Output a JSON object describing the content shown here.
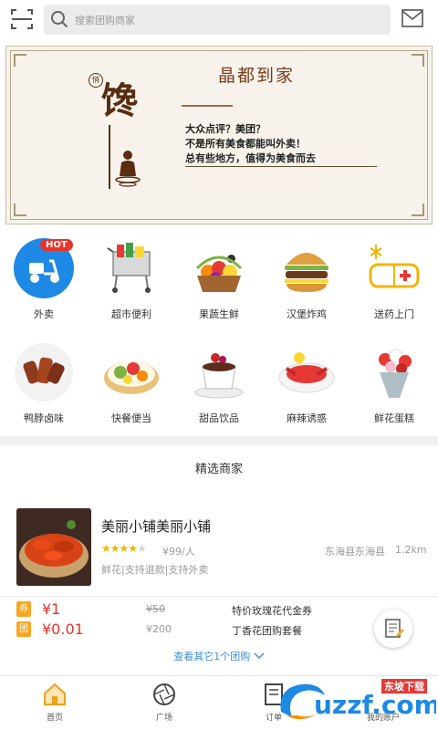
{
  "header": {
    "search_placeholder": "搜索团购商家"
  },
  "banner": {
    "brand": "晶都到家",
    "big_char": "馋",
    "seal_char": "悄",
    "taglines": [
      "大众点评？美团？",
      "不是所有美食都能叫外卖！",
      "总有些地方，值得为美食而去"
    ]
  },
  "categories": [
    {
      "label": "外卖",
      "icon": "scooter-icon",
      "hot": "HOT"
    },
    {
      "label": "超市便利",
      "icon": "shopping-cart-icon"
    },
    {
      "label": "果蔬生鲜",
      "icon": "fruit-basket-icon"
    },
    {
      "label": "汉堡炸鸡",
      "icon": "burger-icon"
    },
    {
      "label": "送药上门",
      "icon": "medicine-icon"
    },
    {
      "label": "鸭脖卤味",
      "icon": "braised-duck-icon"
    },
    {
      "label": "快餐便当",
      "icon": "bento-icon"
    },
    {
      "label": "甜品饮品",
      "icon": "dessert-cup-icon"
    },
    {
      "label": "麻辣诱惑",
      "icon": "crayfish-icon"
    },
    {
      "label": "鲜花蛋糕",
      "icon": "flower-bouquet-icon"
    }
  ],
  "section_title": "精选商家",
  "merchant": {
    "name": "美丽小铺美丽小铺",
    "rating": 4,
    "rating_max": 5,
    "price": "¥99/人",
    "location": "东海县东海县",
    "distance": "1.2km",
    "tags": "鲜花|支持退款|支持外卖"
  },
  "deals": [
    {
      "badge": "券",
      "badge_color": "#f7a623",
      "price": "¥1",
      "original": "¥50",
      "strike": true,
      "name": "特价玫瑰花代金券"
    },
    {
      "badge": "团",
      "badge_color": "#f7a623",
      "price": "¥0.01",
      "original": "¥200",
      "strike": false,
      "name": "丁香花团购套餐"
    }
  ],
  "more_link": "查看其它1个团购",
  "nav": [
    {
      "label": "首页",
      "icon": "home-icon"
    },
    {
      "label": "广场",
      "icon": "aperture-icon"
    },
    {
      "label": "订单",
      "icon": "order-icon"
    },
    {
      "label": "",
      "icon": ""
    },
    {
      "label": "我的账户",
      "icon": "account-icon"
    }
  ],
  "watermark": {
    "text": "uzzf.com",
    "sub": "东坡下载"
  },
  "colors": {
    "accent_red": "#e8332a",
    "link_blue": "#3b8de0",
    "star": "#f4b400",
    "badge": "#f7a623"
  }
}
